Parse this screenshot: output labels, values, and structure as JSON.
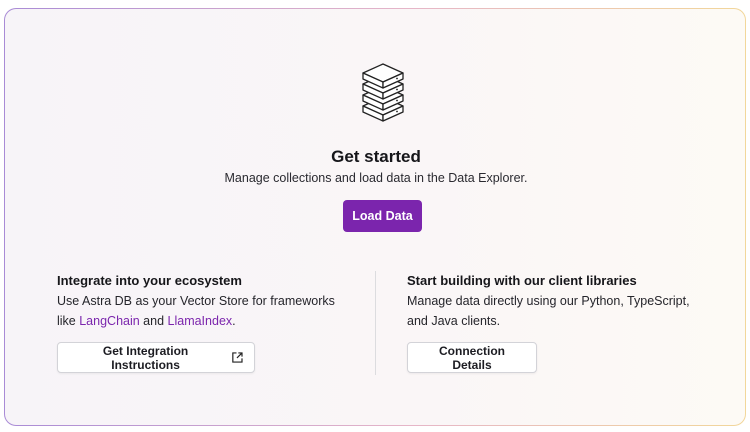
{
  "hero": {
    "icon": "database-stack-icon",
    "title": "Get started",
    "subtitle": "Manage collections and load data in the Data Explorer.",
    "load_button": "Load Data"
  },
  "integrations": {
    "heading": "Integrate into your ecosystem",
    "text_before": "Use Astra DB as your Vector Store for frameworks like ",
    "link1": "LangChain",
    "text_between": " and ",
    "link2": "LlamaIndex",
    "text_after": ".",
    "button": "Get Integration Instructions",
    "button_icon": "external-link-icon"
  },
  "client_libraries": {
    "heading": "Start building with our client libraries",
    "text": "Manage data directly using our Python, TypeScript, and Java clients.",
    "button": "Connection Details"
  },
  "colors": {
    "accent": "#7b25ad",
    "border_gradient": [
      "#a98bd6",
      "#e6b6c8",
      "#f2d79a"
    ]
  }
}
